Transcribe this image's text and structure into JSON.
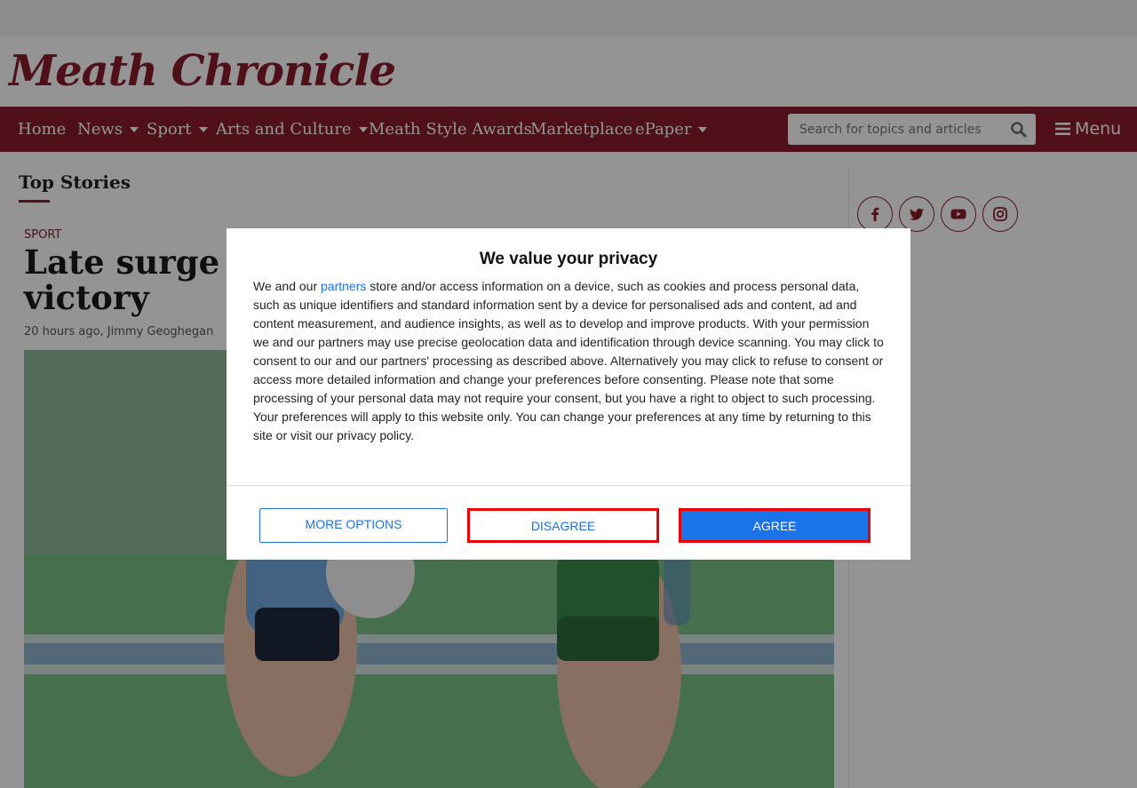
{
  "site": {
    "logo_text": "Meath Chronicle"
  },
  "nav": {
    "items": [
      {
        "label": "Home",
        "dropdown": false
      },
      {
        "label": "News",
        "dropdown": true
      },
      {
        "label": "Sport",
        "dropdown": true
      },
      {
        "label": "Arts and Culture",
        "dropdown": true
      },
      {
        "label": "Meath Style Awards",
        "dropdown": false
      },
      {
        "label": "Marketplace",
        "dropdown": false
      },
      {
        "label": "ePaper",
        "dropdown": true
      }
    ],
    "search_placeholder": "Search for topics and articles",
    "menu_label": "Menu"
  },
  "main": {
    "section_title": "Top Stories",
    "article": {
      "category": "SPORT",
      "headline": "Late surge carries Dublin all the way to victory",
      "byline": "20 hours ago, Jimmy Geoghegan"
    }
  },
  "social": [
    "facebook-icon",
    "twitter-icon",
    "youtube-icon",
    "instagram-icon"
  ],
  "consent": {
    "title": "We value your privacy",
    "body_prefix": "We and our ",
    "partners_link": "partners",
    "body_suffix": " store and/or access information on a device, such as cookies and process personal data, such as unique identifiers and standard information sent by a device for personalised ads and content, ad and content measurement, and audience insights, as well as to develop and improve products. With your permission we and our partners may use precise geolocation data and identification through device scanning. You may click to consent to our and our partners' processing as described above. Alternatively you may click to refuse to consent or access more detailed information and change your preferences before consenting. Please note that some processing of your personal data may not require your consent, but you have a right to object to such processing. Your preferences will apply to this website only. You can change your preferences at any time by returning to this site or visit our privacy policy.",
    "more_options": "MORE OPTIONS",
    "disagree": "DISAGREE",
    "agree": "AGREE"
  },
  "colors": {
    "brand": "#8b1d2c",
    "link": "#1a73e8",
    "highlight": "#e00000"
  }
}
